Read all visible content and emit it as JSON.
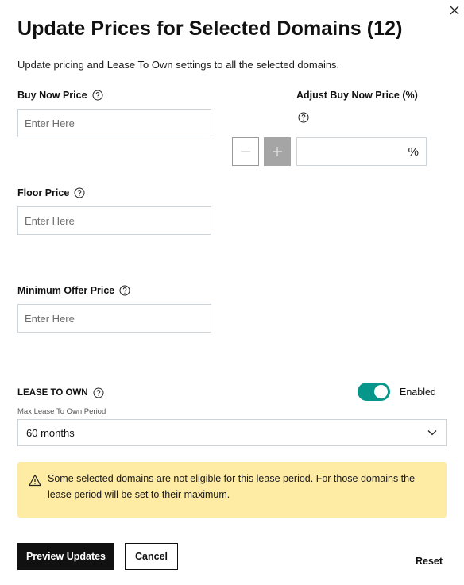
{
  "dialog": {
    "title": "Update Prices for Selected Domains (12)",
    "subtitle": "Update pricing and Lease To Own settings to all the selected domains.",
    "close_icon": "close-icon"
  },
  "fields": {
    "buy_now": {
      "label": "Buy Now Price",
      "placeholder": "Enter Here",
      "value": ""
    },
    "adjust_buy_now": {
      "label": "Adjust Buy Now Price (%)",
      "value": "",
      "suffix": "%",
      "minus_icon": "minus-icon",
      "plus_icon": "plus-icon"
    },
    "floor": {
      "label": "Floor Price",
      "placeholder": "Enter Here",
      "value": ""
    },
    "min_offer": {
      "label": "Minimum Offer Price",
      "placeholder": "Enter Here",
      "value": ""
    }
  },
  "lease_to_own": {
    "label": "LEASE TO OWN",
    "toggle_state": "on",
    "toggle_label": "Enabled",
    "period_label": "Max Lease To Own Period",
    "period_value": "60 months"
  },
  "alert": {
    "icon": "warning-icon",
    "text": "Some selected domains are not eligible for this lease period. For those domains the lease period will be set to their maximum."
  },
  "actions": {
    "preview": "Preview Updates",
    "cancel": "Cancel",
    "reset": "Reset"
  },
  "colors": {
    "toggle_on": "#06968a",
    "alert_bg": "#feeba4",
    "primary_button": "#111111"
  }
}
